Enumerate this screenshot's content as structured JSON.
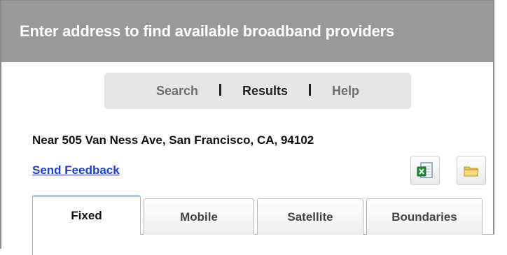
{
  "header": {
    "title": "Enter address to find available broadband providers"
  },
  "nav": {
    "items": [
      {
        "label": "Search",
        "active": false
      },
      {
        "label": "Results",
        "active": true
      },
      {
        "label": "Help",
        "active": false
      }
    ]
  },
  "results": {
    "location_text": "Near 505 Van Ness Ave, San Francisco, CA, 94102",
    "feedback_link": "Send Feedback"
  },
  "toolbar": {
    "export_excel_icon": "excel-icon",
    "folder_icon": "folder-icon"
  },
  "tabs": [
    {
      "label": "Fixed",
      "active": true
    },
    {
      "label": "Mobile",
      "active": false
    },
    {
      "label": "Satellite",
      "active": false
    },
    {
      "label": "Boundaries",
      "active": false
    }
  ],
  "colors": {
    "header_bg": "#999999",
    "link": "#1a3fcf",
    "active_tab_accent": "#a8c8e8"
  }
}
